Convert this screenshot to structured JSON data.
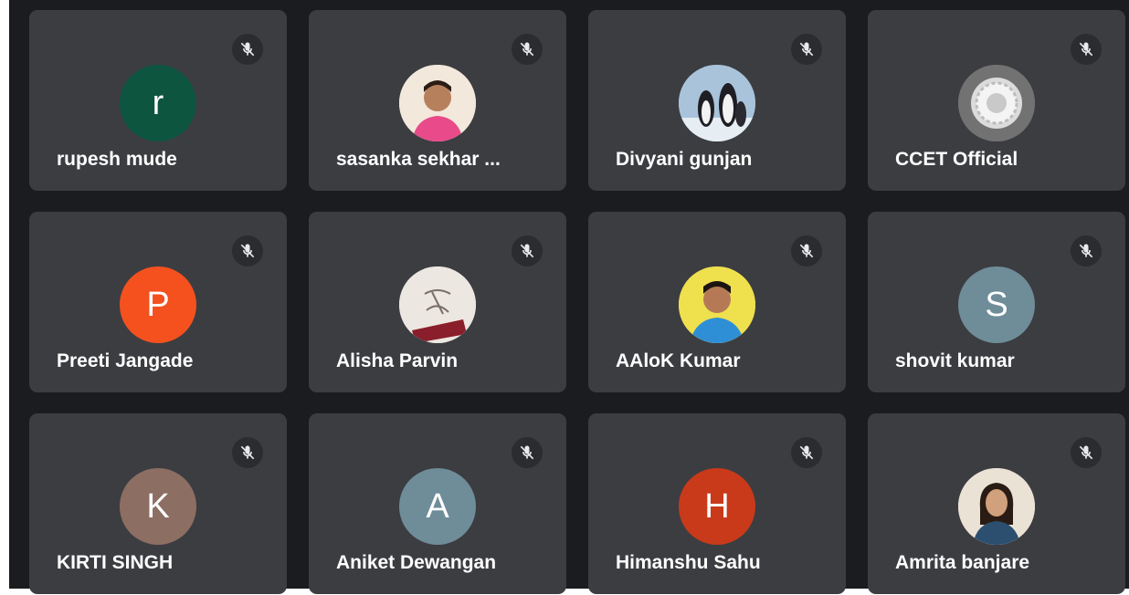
{
  "participants": [
    {
      "name": "rupesh mude",
      "initial": "r",
      "avatar_color": "#0e5540",
      "mic": "muted-mic-icon",
      "photo": false
    },
    {
      "name": "sasanka sekhar ...",
      "initial": "",
      "avatar_color": "#d9c6b5",
      "mic": "muted-mic-icon",
      "photo": true,
      "photo_icon": "profile-photo-man-icon"
    },
    {
      "name": "Divyani gunjan",
      "initial": "",
      "avatar_color": "#9bb7cf",
      "mic": "muted-mic-icon",
      "photo": true,
      "photo_icon": "profile-photo-penguins-icon"
    },
    {
      "name": "CCET Official",
      "initial": "",
      "avatar_color": "#6f6f6f",
      "mic": "muted-mic-icon",
      "photo": true,
      "photo_icon": "profile-photo-emblem-icon"
    },
    {
      "name": "Preeti Jangade",
      "initial": "P",
      "avatar_color": "#f4511e",
      "mic": "muted-mic-icon",
      "photo": false
    },
    {
      "name": "Alisha Parvin",
      "initial": "",
      "avatar_color": "#e9e4df",
      "mic": "muted-mic-icon",
      "photo": true,
      "photo_icon": "profile-photo-letter-icon"
    },
    {
      "name": "AAloK Kumar",
      "initial": "",
      "avatar_color": "#f2e24a",
      "mic": "muted-mic-icon",
      "photo": true,
      "photo_icon": "profile-photo-man-icon"
    },
    {
      "name": "shovit kumar",
      "initial": "S",
      "avatar_color": "#6f8c99",
      "mic": "muted-mic-icon",
      "photo": false
    },
    {
      "name": "KIRTI SINGH",
      "initial": "K",
      "avatar_color": "#8d6e63",
      "mic": "muted-mic-icon",
      "photo": false
    },
    {
      "name": "Aniket Dewangan",
      "initial": "A",
      "avatar_color": "#6f8c99",
      "mic": "muted-mic-icon",
      "photo": false
    },
    {
      "name": "Himanshu Sahu",
      "initial": "H",
      "avatar_color": "#c83a1a",
      "mic": "muted-mic-icon",
      "photo": false
    },
    {
      "name": "Amrita banjare",
      "initial": "",
      "avatar_color": "#e7ddd0",
      "mic": "muted-mic-icon",
      "photo": true,
      "photo_icon": "profile-photo-woman-icon"
    }
  ],
  "colors": {
    "background": "#1b1c1f",
    "tile": "#3c3d41",
    "mic_bg": "#2b2c2f",
    "text": "#ffffff"
  }
}
